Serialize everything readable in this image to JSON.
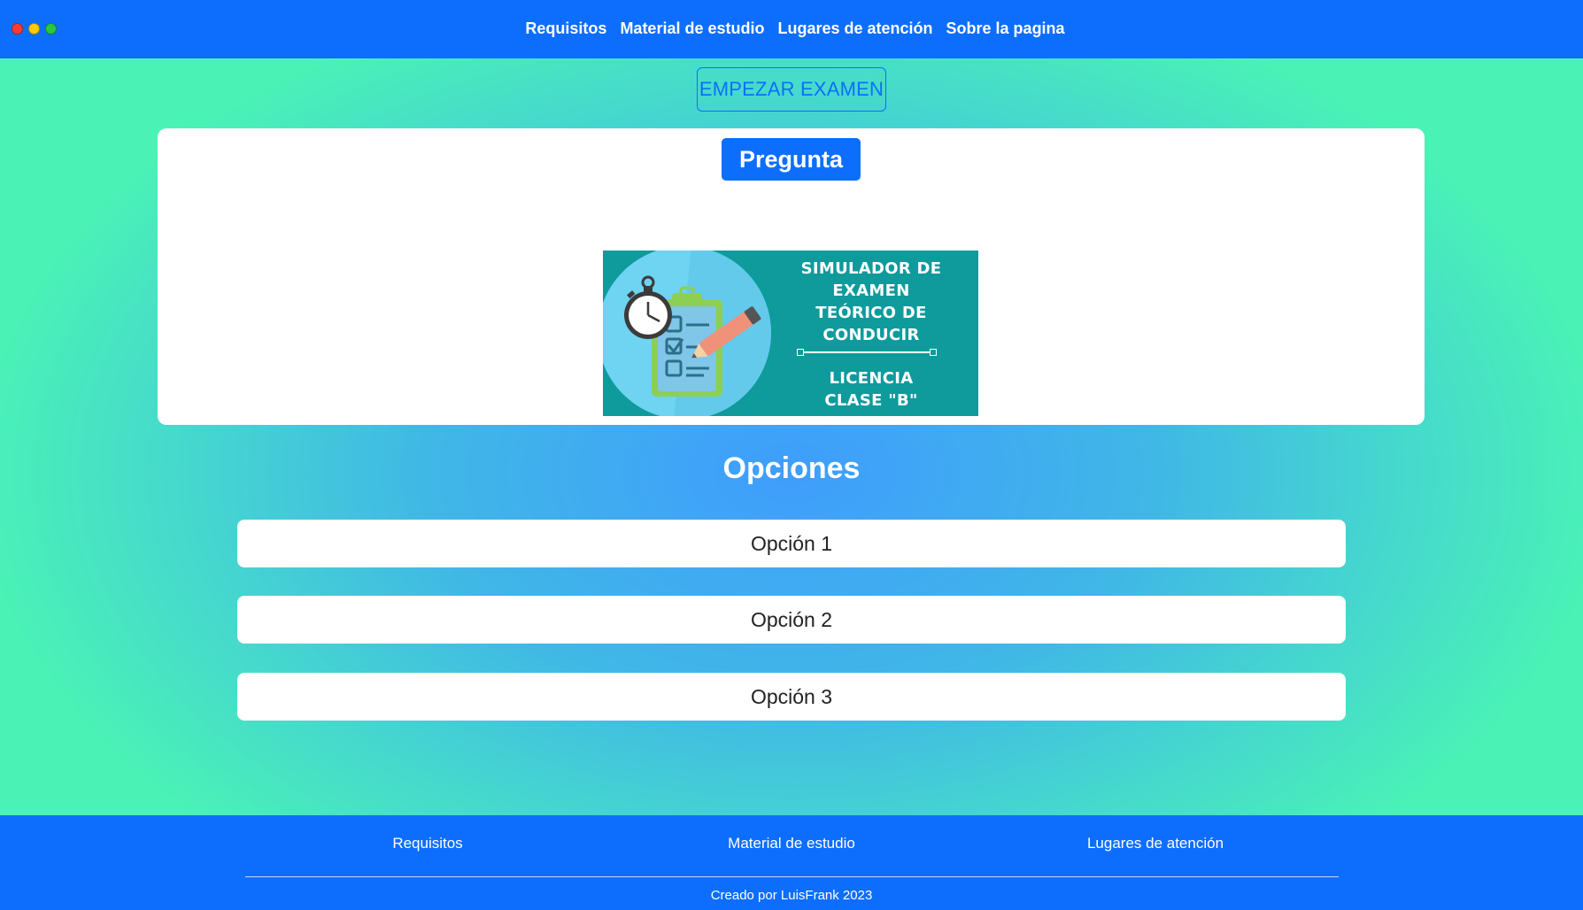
{
  "nav": {
    "items": [
      {
        "label": "Requisitos"
      },
      {
        "label": "Material de estudio"
      },
      {
        "label": "Lugares de atención"
      },
      {
        "label": "Sobre la pagina"
      }
    ]
  },
  "start_button": {
    "label": "EMPEZAR EXAMEN"
  },
  "question": {
    "badge": "Pregunta",
    "banner": {
      "title_lines": [
        "SIMULADOR DE",
        "EXAMEN",
        "TEÓRICO DE",
        "CONDUCIR"
      ],
      "subtitle_lines": [
        "LICENCIA",
        "CLASE \"B\""
      ]
    }
  },
  "options": {
    "title": "Opciones",
    "items": [
      {
        "label": "Opción 1"
      },
      {
        "label": "Opción 2"
      },
      {
        "label": "Opción 3"
      }
    ]
  },
  "footer": {
    "links": [
      {
        "label": "Requisitos"
      },
      {
        "label": "Material de estudio"
      },
      {
        "label": "Lugares de atención"
      }
    ],
    "credit": "Creado por LuisFrank 2023"
  },
  "colors": {
    "primary": "#0d6efd",
    "banner_bg": "#0f9a9c",
    "gradient_center": "#3f9dfd",
    "gradient_edge": "#4af3b5"
  }
}
